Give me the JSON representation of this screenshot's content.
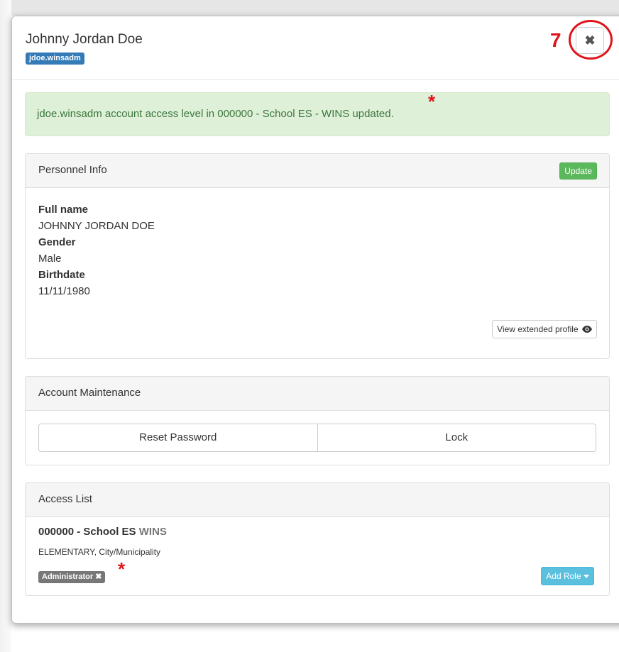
{
  "modal": {
    "title": "Johnny Jordan Doe",
    "username": "jdoe.winsadm",
    "close_glyph": "✖",
    "step_number": "7"
  },
  "alert": {
    "message": "jdoe.winsadm account access level in 000000 - School ES - WINS updated."
  },
  "annotation": {
    "star": "*"
  },
  "personnel": {
    "heading": "Personnel Info",
    "update_label": "Update",
    "fields": [
      {
        "label": "Full name",
        "value": "JOHNNY JORDAN DOE"
      },
      {
        "label": "Gender",
        "value": "Male"
      },
      {
        "label": "Birthdate",
        "value": "11/11/1980"
      }
    ],
    "extended_label": "View extended profile"
  },
  "maintenance": {
    "heading": "Account Maintenance",
    "reset_label": "Reset Password",
    "lock_label": "Lock"
  },
  "access": {
    "heading": "Access List",
    "school_name": "000000 - School ES",
    "system": "WINS",
    "school_type": "ELEMENTARY, City/Municipality",
    "role": "Administrator",
    "role_remove_glyph": "✖",
    "add_role_label": "Add Role"
  },
  "colors": {
    "primary": "#337ab7",
    "success": "#5cb85c",
    "info": "#5bc0de",
    "annotation_red": "#e0141c",
    "alert_bg": "#dff0d8",
    "alert_text": "#3c763d"
  }
}
